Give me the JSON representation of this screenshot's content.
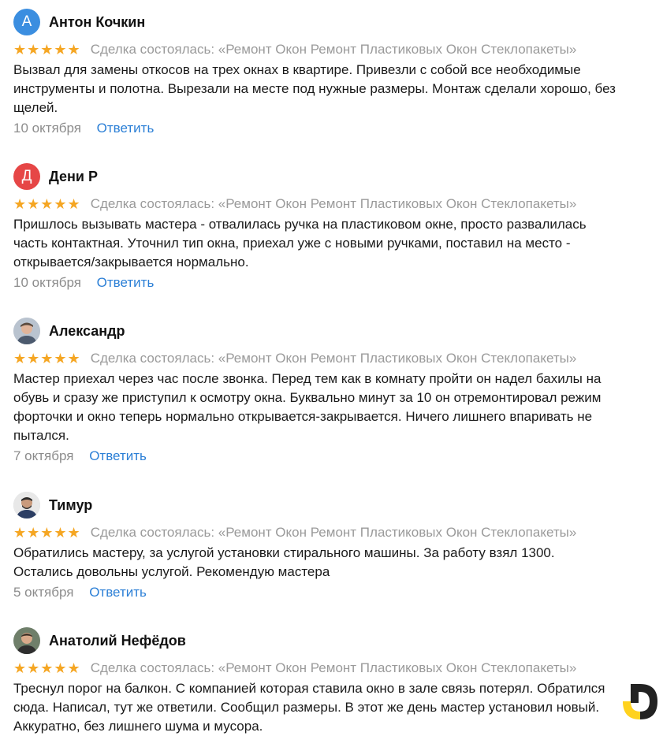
{
  "reviews": [
    {
      "avatar_letter": "А",
      "name": "Антон Кочкин",
      "stars": "★★★★★",
      "deal": "Сделка состоялась: «Ремонт Окон Ремонт Пластиковых Окон Стеклопакеты»",
      "text": "Вызвал для замены откосов на трех окнах в квартире. Привезли с собой все необходимые\nинструменты и полотна. Вырезали на месте под нужные размеры. Монтаж сделали хорошо, без\nщелей.",
      "date": "10 октября",
      "reply": "Ответить"
    },
    {
      "avatar_letter": "Д",
      "name": "Дени Р",
      "stars": "★★★★★",
      "deal": "Сделка состоялась: «Ремонт Окон Ремонт Пластиковых Окон Стеклопакеты»",
      "text": "Пришлось вызывать мастера - отвалилась ручка на пластиковом окне, просто развалилась\nчасть контактная. Уточнил тип окна, приехал уже с новыми ручками, поставил на место -\nоткрывается/закрывается нормально.",
      "date": "10 октября",
      "reply": "Ответить"
    },
    {
      "name": "Александр",
      "stars": "★★★★★",
      "deal": "Сделка состоялась: «Ремонт Окон Ремонт Пластиковых Окон Стеклопакеты»",
      "text": "Мастер приехал через час после звонка. Перед тем как в комнату пройти он надел бахилы на\nобувь и сразу же приступил к осмотру окна. Буквально минут за 10 он отремонтировал режим\nфорточки и окно теперь нормально открывается-закрывается. Ничего лишнего впаривать не\nпытался.",
      "date": "7 октября",
      "reply": "Ответить"
    },
    {
      "name": "Тимур",
      "stars": "★★★★★",
      "deal": "Сделка состоялась: «Ремонт Окон Ремонт Пластиковых Окон Стеклопакеты»",
      "text": "Обратились мастеру, за услугой установки стирального машины. За работу взял 1300.\nОстались довольны услугой. Рекомендую мастера",
      "date": "5 октября",
      "reply": "Ответить"
    },
    {
      "name": "Анатолий Нефёдов",
      "stars": "★★★★★",
      "deal": "Сделка состоялась: «Ремонт Окон Ремонт Пластиковых Окон Стеклопакеты»",
      "text": "Треснул порог на балкон. С компанией которая ставила окно в зале связь потерял. Обратился\nсюда. Написал, тут же ответили. Сообщил размеры. В этот же день мастер установил новый.\nАккуратно, без лишнего шума и мусора."
    }
  ],
  "colors": {
    "star": "#f5a623",
    "link": "#2b7fd6",
    "muted": "#9a9a9a",
    "logo_yellow": "#ffd21e",
    "logo_dark": "#222222"
  }
}
